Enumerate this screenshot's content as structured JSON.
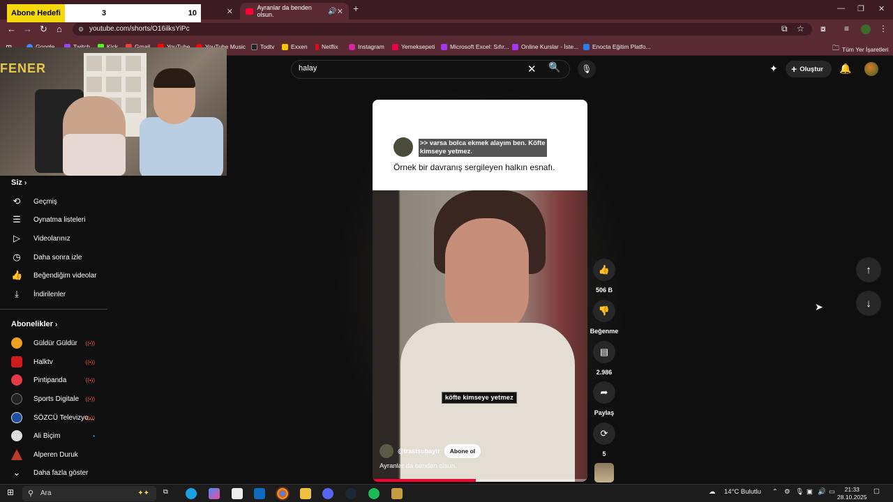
{
  "browser": {
    "tabs": [
      {
        "label": ""
      },
      {
        "label": "Ayranlar da benden olsun."
      }
    ],
    "new_tab": "+",
    "url": "youtube.com/shorts/O16ilksYiPc",
    "bookmarks": [
      {
        "label": "Google",
        "color": "#4285f4"
      },
      {
        "label": "Twitch",
        "color": "#9146ff"
      },
      {
        "label": "Kick",
        "color": "#53fc18"
      },
      {
        "label": "Gmail",
        "color": "#ea4335"
      },
      {
        "label": "YouTube",
        "color": "#ff0000"
      },
      {
        "label": "YouTube Music",
        "color": "#ff0000"
      },
      {
        "label": "Todtv",
        "color": "#222222"
      },
      {
        "label": "Exxen",
        "color": "#f6c400"
      },
      {
        "label": "Netflix",
        "color": "#e50914"
      },
      {
        "label": "Instagram",
        "color": "#d6249f"
      },
      {
        "label": "Yemeksepeti",
        "color": "#ea004b"
      },
      {
        "label": "Microsoft Excel: Sıfır...",
        "color": "#a435f0"
      },
      {
        "label": "Online Kurslar - İste...",
        "color": "#a435f0"
      },
      {
        "label": "Enocta Eğitim Platfo...",
        "color": "#2b7de9"
      }
    ],
    "all_bookmarks": "Tüm Yer İşaretleri"
  },
  "overlay": {
    "label": "Abone Hedefi",
    "current": "3",
    "goal": "10"
  },
  "sidebar": {
    "you_title": "Siz",
    "you_items": [
      {
        "label": "Geçmiş",
        "icon": "history-icon"
      },
      {
        "label": "Oynatma listeleri",
        "icon": "playlist-icon"
      },
      {
        "label": "Videolarınız",
        "icon": "your-videos-icon"
      },
      {
        "label": "Daha sonra izle",
        "icon": "watch-later-icon"
      },
      {
        "label": "Beğendiğim videolar",
        "icon": "liked-icon"
      },
      {
        "label": "İndirilenler",
        "icon": "download-icon"
      }
    ],
    "subs_title": "Abonelikler",
    "subs": [
      {
        "label": "Güldür Güldür",
        "color": "#f0a020",
        "live": true
      },
      {
        "label": "Halktv",
        "color": "#d11a1a",
        "live": true
      },
      {
        "label": "Pintipanda",
        "color": "#e63946",
        "live": true
      },
      {
        "label": "Sports Digitale",
        "color": "#222222",
        "live": true
      },
      {
        "label": "SÖZCÜ Televizyo...",
        "color": "#1f4fa3",
        "live": true
      },
      {
        "label": "Ali Biçim",
        "color": "#dddddd",
        "live": false
      },
      {
        "label": "Alperen Duruk",
        "color": "#c0392b",
        "live": false
      }
    ],
    "show_more": "Daha fazla göster"
  },
  "header": {
    "search_value": "halay",
    "create_label": "Oluştur"
  },
  "short": {
    "tweet_highlight": ">> varsa bolca ekmek alayım ben. Köfte kimseye yetmez.",
    "tweet_body": "Örnek bir davranış sergileyen halkın esnafı.",
    "caption": "köfte kimseye yetmez",
    "channel": "@trastsubaytr",
    "subscribe": "Abone ol",
    "title": "Ayranlar da benden olsun.",
    "progress_fraction": 0.48
  },
  "actions": {
    "likes": "506 B",
    "dislike": "Beğenme",
    "comments": "2.986",
    "share": "Paylaş",
    "remix": "5"
  },
  "taskbar": {
    "search": "Ara",
    "weather": "14°C Bulutlu",
    "time": "21:33",
    "date": "28.10.2025"
  }
}
